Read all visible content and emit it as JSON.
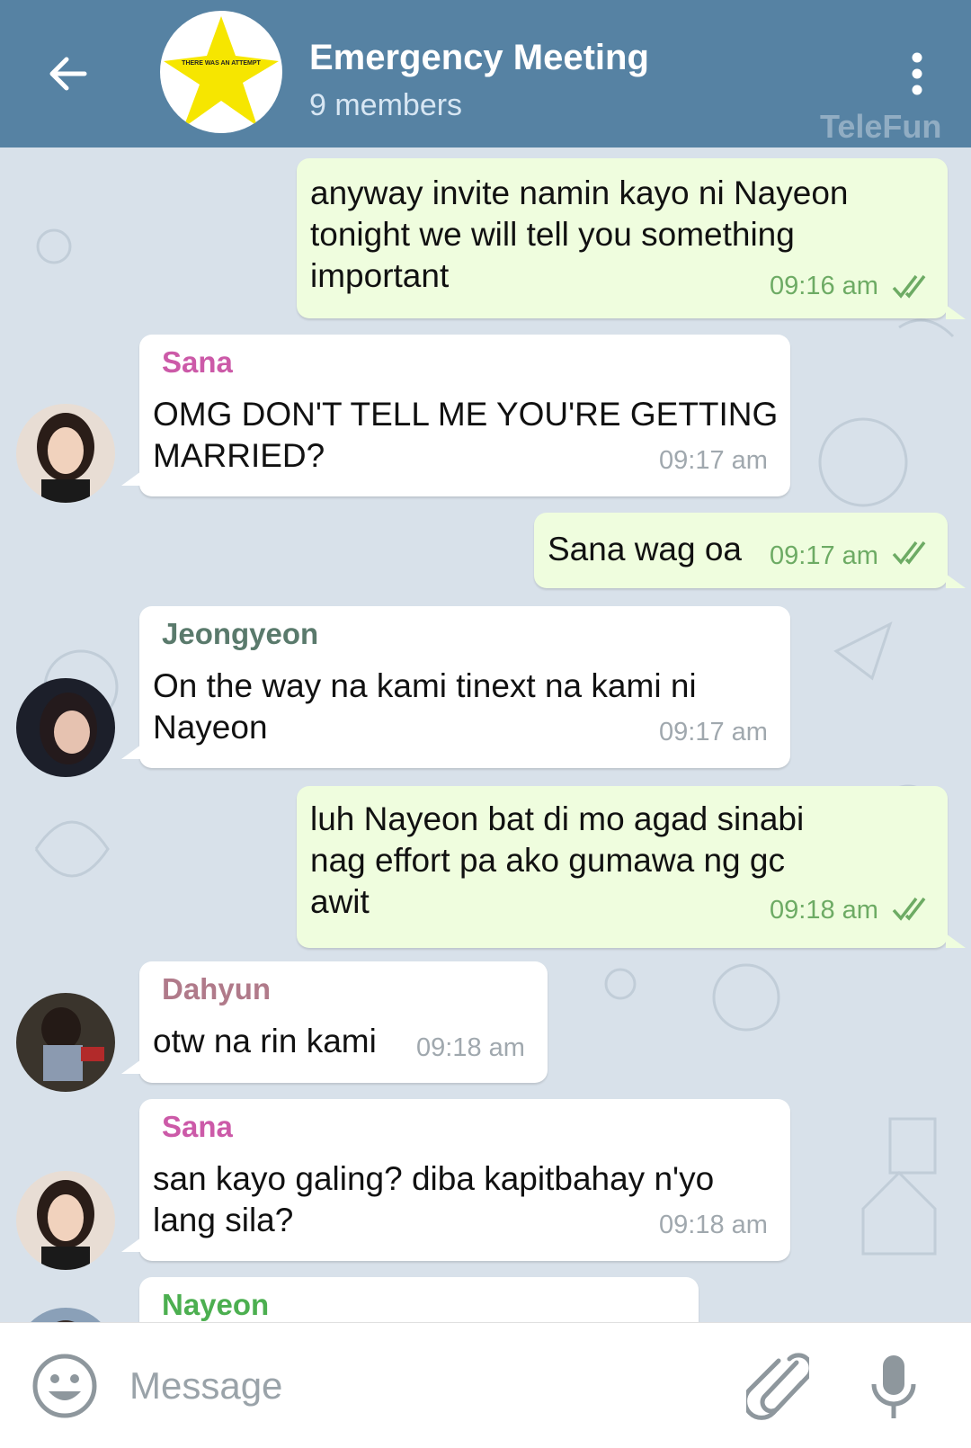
{
  "header": {
    "title": "Emergency Meeting",
    "subtitle": "9 members",
    "watermark": "TeleFun",
    "group_avatar_text": "THERE WAS AN ATTEMPT"
  },
  "messages": [
    {
      "dir": "out",
      "text": "anyway invite namin kayo ni Nayeon\ntonight we will tell you something\nimportant",
      "time": "09:16 am"
    },
    {
      "dir": "in",
      "sender": "Sana",
      "text": "OMG DON'T TELL ME YOU'RE GETTING\nMARRIED?",
      "time": "09:17 am"
    },
    {
      "dir": "out",
      "text": "Sana wag oa",
      "time": "09:17 am"
    },
    {
      "dir": "in",
      "sender": "Jeongyeon",
      "text": "On the way na kami tinext na kami ni\nNayeon",
      "time": "09:17 am"
    },
    {
      "dir": "out",
      "text": "luh Nayeon bat di mo agad sinabi\nnag effort pa ako gumawa ng gc\nawit",
      "time": "09:18 am"
    },
    {
      "dir": "in",
      "sender": "Dahyun",
      "text": "otw na rin kami",
      "time": "09:18 am"
    },
    {
      "dir": "in",
      "sender": "Sana",
      "text": "san kayo galing? diba kapitbahay n'yo\nlang sila?",
      "time": "09:18 am"
    },
    {
      "dir": "in",
      "sender": "Nayeon",
      "text": "",
      "time": ""
    }
  ],
  "input": {
    "placeholder": "Message"
  },
  "colors": {
    "header": "#5682a3",
    "outgoing_bubble": "#effdde",
    "incoming_bubble": "#ffffff",
    "sana": "#cc5aa8",
    "jeongyeon": "#5a7a6c",
    "dahyun": "#b07a8a",
    "nayeon": "#4caf50",
    "checks": "#6dab64"
  },
  "icons": [
    "back-arrow-icon",
    "kebab-menu-icon",
    "double-check-icon",
    "emoji-icon",
    "attach-icon",
    "mic-icon"
  ]
}
